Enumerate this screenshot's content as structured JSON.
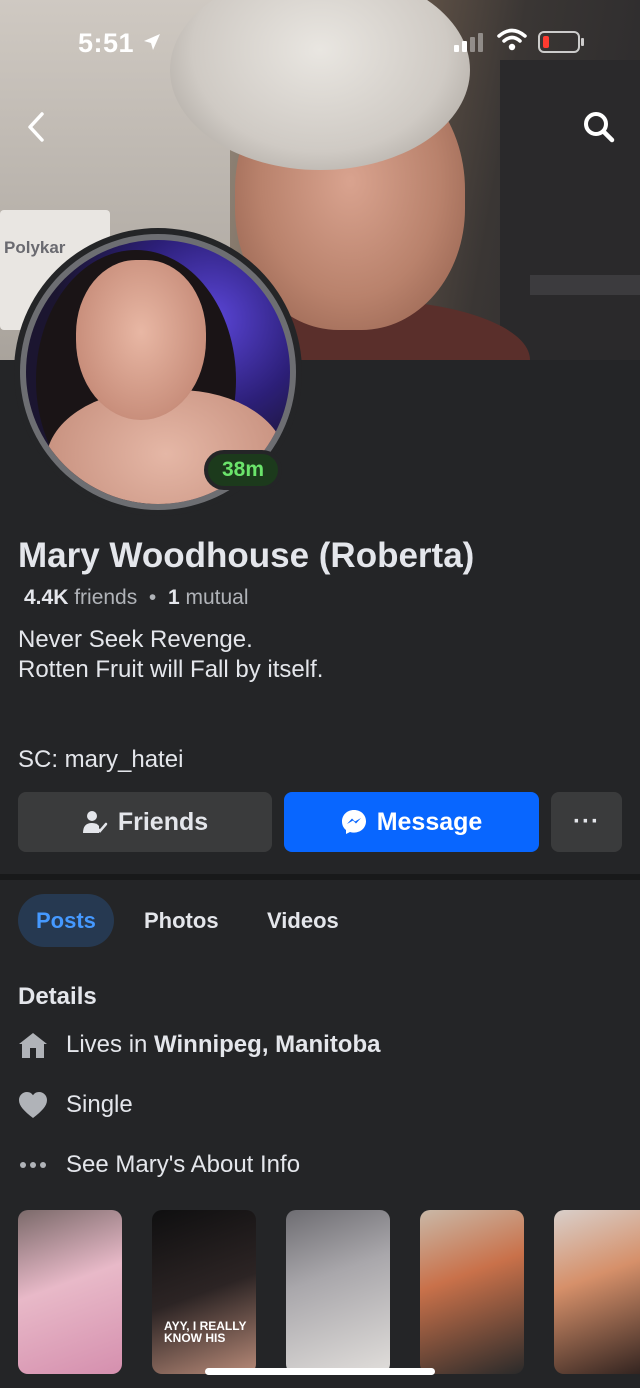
{
  "status_bar": {
    "time": "5:51",
    "location_arrow": "➤"
  },
  "cover": {
    "box_label": "Polykar"
  },
  "profile": {
    "name": "Mary Woodhouse (Roberta)",
    "friends_count": "4.4K",
    "friends_label": "friends",
    "separator": "•",
    "mutual_count": "1",
    "mutual_label": "mutual",
    "bio_line1": "Never Seek Revenge.",
    "bio_line2": "Rotten Fruit will Fall by itself.",
    "sc": "SC: mary_hatei",
    "active_badge": "38m"
  },
  "actions": {
    "friends_label": "Friends",
    "message_label": "Message",
    "more_label": "···"
  },
  "tabs": [
    {
      "label": "Posts",
      "active": true
    },
    {
      "label": "Photos",
      "active": false
    },
    {
      "label": "Videos",
      "active": false
    }
  ],
  "details": {
    "title": "Details",
    "lives_prefix": "Lives in ",
    "lives_city": "Winnipeg, Manitoba",
    "relationship": "Single",
    "about_link": "See Mary's About Info"
  },
  "highlights": {
    "caption_2": "AYY, I REALLY KNOW HIS"
  },
  "colors": {
    "background": "#242527",
    "accent_blue": "#0866ff",
    "active_tab_bg": "#263951",
    "active_tab_text": "#4599ff",
    "online_green": "#6be46b",
    "battery_low": "#ff3b30"
  },
  "icons": {
    "back": "chevron-left-icon",
    "search": "search-icon",
    "friends": "friend-check-icon",
    "message": "messenger-icon",
    "home": "home-icon",
    "heart": "heart-icon",
    "more": "more-dots-icon"
  }
}
